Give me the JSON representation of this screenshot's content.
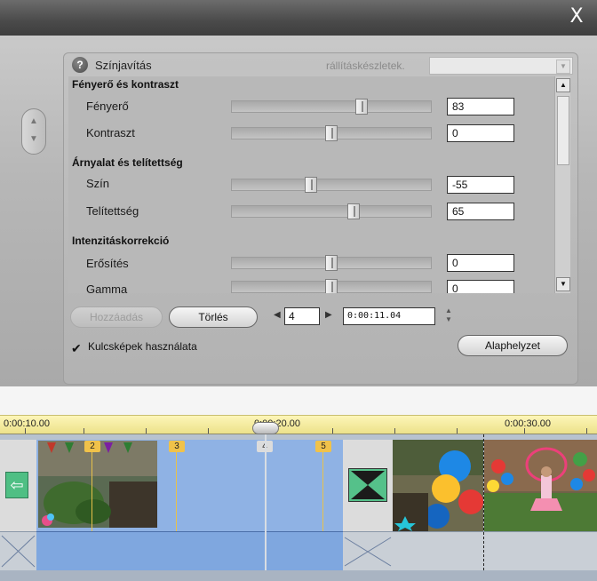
{
  "window": {
    "close_label": "X"
  },
  "panel": {
    "title": "Színjavítás",
    "preset_label": "rállításkészletek.",
    "preset_value": ""
  },
  "sections": [
    {
      "title": "Fényerő és kontraszt"
    },
    {
      "title": "Árnyalat és telítettség"
    },
    {
      "title": "Intenzitáskorrekció"
    }
  ],
  "rows": [
    {
      "label": "Fényerő",
      "value": "83",
      "level": 0.66
    },
    {
      "label": "Kontraszt",
      "value": "0",
      "level": 0.5
    },
    {
      "label": "Szín",
      "value": "-55",
      "level": 0.39
    },
    {
      "label": "Telítettség",
      "value": "65",
      "level": 0.62
    },
    {
      "label": "Erősítés",
      "value": "0",
      "level": 0.5
    },
    {
      "label": "Gamma",
      "value": "0",
      "level": 0.5
    }
  ],
  "keyframes": {
    "add_label": "Hozzáadás",
    "delete_label": "Törlés",
    "current": "4",
    "time": "0:00:11.04",
    "use_label": "Kulcsképek használata",
    "use_checked": true,
    "reset_label": "Alaphelyzet"
  },
  "timeline": {
    "ticks": [
      "0:00:10.00",
      "0:00:20.00",
      "0:00:30.00"
    ],
    "markers": [
      "2",
      "3",
      "4",
      "5"
    ]
  },
  "colors": {
    "ruler": "#f2e99a",
    "clip_blue": "#8fb2e4",
    "marker": "#f0c24a",
    "marker_selected": "#d8d8d8",
    "transition": "#55c18a"
  }
}
